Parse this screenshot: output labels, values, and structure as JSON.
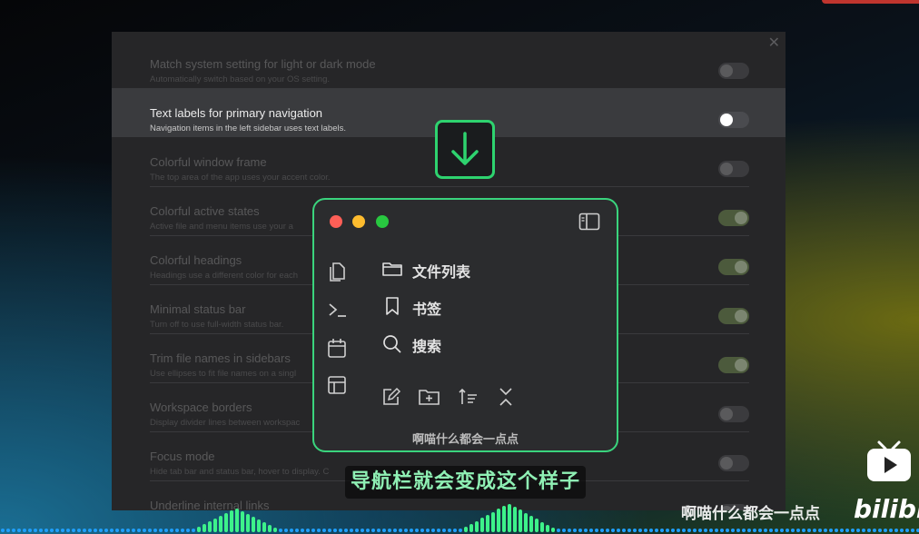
{
  "settings": {
    "rows": [
      {
        "title": "Match system setting for light or dark mode",
        "desc": "Automatically switch based on your OS setting.",
        "on": false,
        "highlight": false
      },
      {
        "title": "Text labels for primary navigation",
        "desc": "Navigation items in the left sidebar uses text labels.",
        "on": false,
        "highlight": true
      },
      {
        "title": "Colorful window frame",
        "desc": "The top area of the app uses your accent color.",
        "on": false,
        "highlight": false
      },
      {
        "title": "Colorful active states",
        "desc": "Active file and menu items use your a",
        "on": true,
        "highlight": false
      },
      {
        "title": "Colorful headings",
        "desc": "Headings use a different color for each",
        "on": true,
        "highlight": false
      },
      {
        "title": "Minimal status bar",
        "desc": "Turn off to use full-width status bar.",
        "on": true,
        "highlight": false
      },
      {
        "title": "Trim file names in sidebars",
        "desc": "Use ellipses to fit file names on a singl",
        "on": true,
        "highlight": false
      },
      {
        "title": "Workspace borders",
        "desc": "Display divider lines between workspac",
        "on": false,
        "highlight": false
      },
      {
        "title": "Focus mode",
        "desc": "Hide tab bar and status bar, hover to display. C",
        "on": false,
        "highlight": false
      },
      {
        "title": "Underline internal links",
        "desc": "",
        "on": false,
        "highlight": false
      }
    ]
  },
  "popup": {
    "nav": {
      "files": "文件列表",
      "bookmarks": "书签",
      "search": "搜索"
    },
    "footer": "啊喵什么都会一点点"
  },
  "subtitle": "导航栏就会变成这个样子",
  "watermark": "啊喵什么都会一点点",
  "brand": "bilibili",
  "colors": {
    "accent_green": "#2ed36f",
    "light_red": "#fe5f57",
    "light_yellow": "#febc2e",
    "light_green": "#28c840"
  },
  "icons": [
    "close-icon",
    "arrow-down-icon",
    "sidebar-toggle-icon",
    "copy-files-icon",
    "terminal-icon",
    "calendar-icon",
    "layout-icon",
    "folder-icon",
    "bookmark-icon",
    "search-icon",
    "new-note-icon",
    "new-folder-icon",
    "sort-icon",
    "collapse-icon",
    "bilibili-tv-icon"
  ]
}
